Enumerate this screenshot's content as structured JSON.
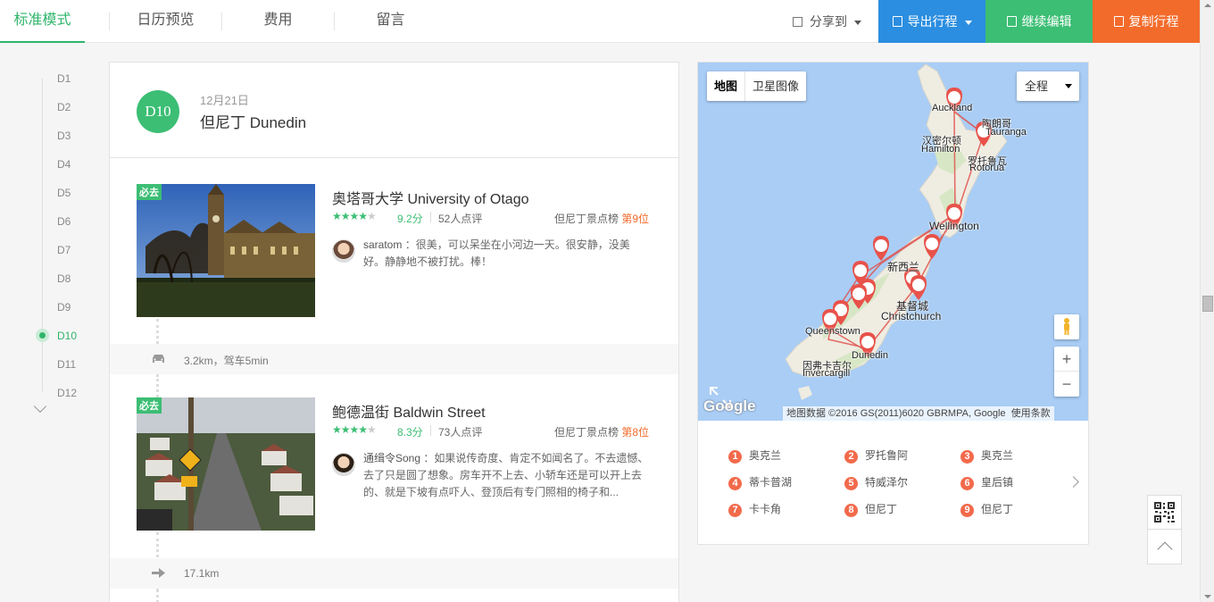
{
  "tabs": [
    {
      "label": "标准模式",
      "active": true
    },
    {
      "label": "日历预览",
      "active": false
    },
    {
      "label": "费用",
      "active": false
    },
    {
      "label": "留言",
      "active": false
    }
  ],
  "actions": {
    "share": "分享到",
    "export": "导出行程",
    "edit": "继续编辑",
    "copy": "复制行程"
  },
  "colors": {
    "accent_green": "#3cbe74",
    "export_blue": "#2b8ee0",
    "copy_orange": "#f36b2b",
    "pin_red": "#f26a4b"
  },
  "days": [
    "D1",
    "D2",
    "D3",
    "D4",
    "D5",
    "D6",
    "D7",
    "D8",
    "D9",
    "D10",
    "D11",
    "D12"
  ],
  "active_day": "D10",
  "day": {
    "badge": "D10",
    "date": "12月21日",
    "city": "但尼丁 Dunedin"
  },
  "spots": [
    {
      "must": "必去",
      "name": "奥塔哥大学 University of Otago",
      "rating_stars": 4,
      "score": "9.2分",
      "reviews": "52人点评",
      "rank_prefix": "但尼丁景点榜",
      "rank": "第9位",
      "comment_user": "saratom",
      "comment_text": "：很美，可以呆坐在小河边一天。很安静，没美好。静静地不被打扰。棒！",
      "image_icon": "university-clocktower-photo"
    },
    {
      "must": "必去",
      "name": "鲍德温街 Baldwin Street",
      "rating_stars": 4,
      "score": "8.3分",
      "reviews": "73人点评",
      "rank_prefix": "但尼丁景点榜",
      "rank": "第8位",
      "comment_user": "通缉令Song",
      "comment_text": "：如果说传奇度、肯定不如闻名了。不去遗憾、去了只是圆了想象。房车开不上去、小轿车还是可以开上去的、就是下坡有点吓人、登顶后有专门照相的椅子和...",
      "image_icon": "steep-street-photo"
    }
  ],
  "transits": [
    {
      "icon": "car-icon",
      "text": "3.2km，驾车5min"
    },
    {
      "icon": "arrow-right-icon",
      "text": "17.1km"
    }
  ],
  "map": {
    "type_map": "地图",
    "type_satellite": "卫星图像",
    "range": "全程",
    "attribution": "地图数据 ©2016 GS(2011)6020 GBRMPA, Google",
    "terms": "使用条款",
    "google": "Google",
    "labels": {
      "auckland": "Auckland",
      "tauranga_cn": "陶朗哥",
      "tauranga": "Tauranga",
      "hamilton_cn": "汉密尔顿",
      "hamilton": "Hamilton",
      "rotorua_cn": "罗托鲁瓦",
      "rotorua": "Rotorua",
      "wellington": "Wellington",
      "nz_cn": "新西兰",
      "christchurch_cn": "基督城",
      "christchurch": "Christchurch",
      "queenstown": "Queenstown",
      "dunedin": "Dunedin",
      "invercargill_cn": "因弗卡吉尔",
      "invercargill": "Invercargill"
    }
  },
  "stops": [
    {
      "n": "1",
      "name": "奥克兰"
    },
    {
      "n": "2",
      "name": "罗托鲁阿"
    },
    {
      "n": "3",
      "name": "奥克兰"
    },
    {
      "n": "4",
      "name": "蒂卡普湖"
    },
    {
      "n": "5",
      "name": "特威泽尔"
    },
    {
      "n": "6",
      "name": "皇后镇"
    },
    {
      "n": "7",
      "name": "卡卡角"
    },
    {
      "n": "8",
      "name": "但尼丁"
    },
    {
      "n": "9",
      "name": "但尼丁"
    }
  ]
}
